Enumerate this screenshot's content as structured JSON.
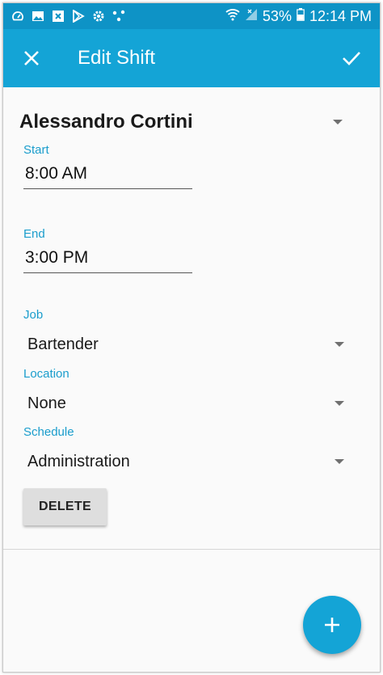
{
  "status_bar": {
    "battery": "53%",
    "time": "12:14 PM",
    "left_icons": [
      "speedometer-icon",
      "image-icon",
      "close-box-icon",
      "play-store-icon",
      "settings-cog-icon",
      "share-dots-icon"
    ],
    "right_icons": [
      "wifi-icon",
      "signal-icon",
      "battery-icon"
    ]
  },
  "toolbar": {
    "title": "Edit Shift",
    "close_icon": "close-icon",
    "confirm_icon": "check-icon"
  },
  "form": {
    "employee": "Alessandro Cortini",
    "start_label": "Start",
    "start_value": "8:00 AM",
    "end_label": "End",
    "end_value": "3:00 PM",
    "job_label": "Job",
    "job_value": "Bartender",
    "location_label": "Location",
    "location_value": "None",
    "schedule_label": "Schedule",
    "schedule_value": "Administration",
    "delete_label": "DELETE"
  },
  "fab": {
    "icon": "plus-icon"
  },
  "colors": {
    "status_bar": "#0e93c6",
    "toolbar": "#14a4d6",
    "accent_label": "#1a9dcc",
    "delete_bg": "#dedede"
  }
}
